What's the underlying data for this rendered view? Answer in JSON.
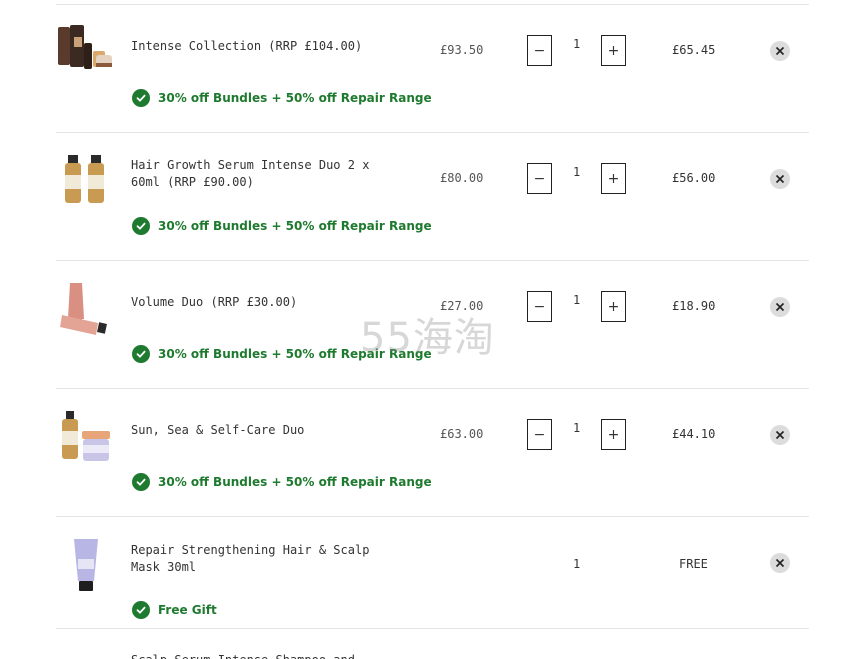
{
  "cart": {
    "items": [
      {
        "name": "Intense Collection (RRP £104.00)",
        "price": "£93.50",
        "quantity": "1",
        "total": "£65.45",
        "promo": "30% off Bundles + 50% off Repair Range",
        "product_image": "hair-care-collection-image"
      },
      {
        "name": "Hair Growth Serum Intense Duo 2 x 60ml (RRP £90.00)",
        "price": "£80.00",
        "quantity": "1",
        "total": "£56.00",
        "promo": "30% off Bundles + 50% off Repair Range",
        "product_image": "serum-bottles-image"
      },
      {
        "name": "Volume Duo (RRP £30.00)",
        "price": "£27.00",
        "quantity": "1",
        "total": "£18.90",
        "promo": "30% off Bundles + 50% off Repair Range",
        "product_image": "volume-tubes-image"
      },
      {
        "name": "Sun, Sea & Self-Care Duo",
        "price": "£63.00",
        "quantity": "1",
        "total": "£44.10",
        "promo": "30% off Bundles + 50% off Repair Range",
        "product_image": "bottle-and-jar-image"
      },
      {
        "name": "Repair Strengthening Hair & Scalp Mask 30ml",
        "price": "",
        "quantity": "1",
        "total": "FREE",
        "promo": "Free Gift",
        "product_image": "mask-tube-image"
      }
    ],
    "partial_next_item": "Scalp Serum Intense Shampoo and"
  },
  "controls": {
    "decrease": "−",
    "increase": "+"
  },
  "watermark": "55海淘",
  "colors": {
    "promo_green": "#1e7a2e",
    "divider": "#e4e4e4",
    "remove_bg": "#dcdcdc"
  }
}
